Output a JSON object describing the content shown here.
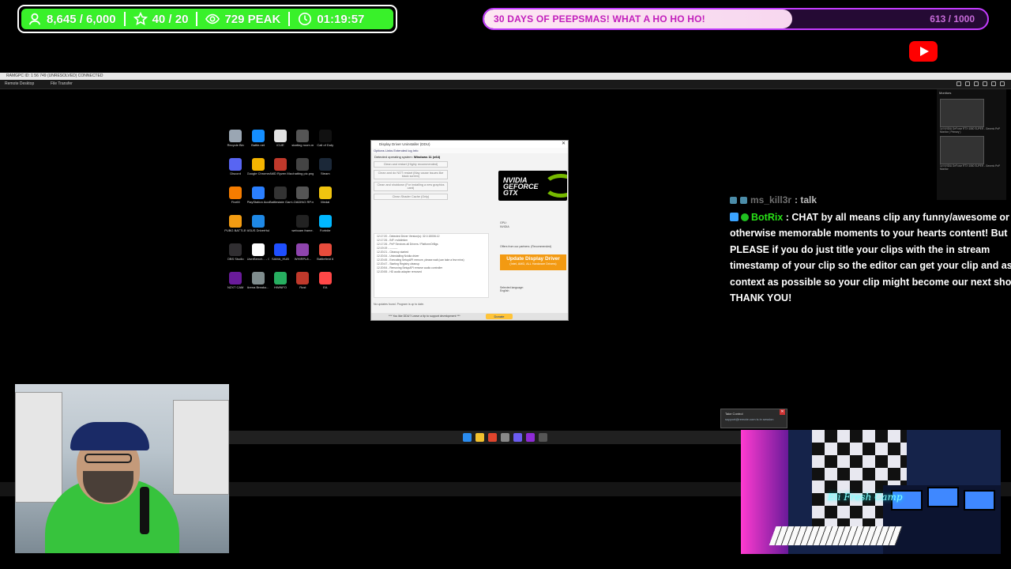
{
  "stats": {
    "followers": "8,645 / 6,000",
    "subs": "40 / 20",
    "viewers": "729 PEAK",
    "uptime": "01:19:57"
  },
  "goal": {
    "title": "30 DAYS OF PEEPSMAS! WHAT A HO HO HO!",
    "count": "613 / 1000",
    "progress_percent": 61.3
  },
  "remote_desktop": {
    "title": "RAMGPC  ID: 1 56 749 (UNRESOLVED) CONNECTED",
    "tabs": [
      "Remote Desktop",
      "File Transfer"
    ],
    "monitors_label": "Monitors",
    "monitor_captions": [
      "1# NVIDIA GeForce RTX 4080 SUPER - Generic PnP Monitor ( Primary )",
      "1# NVIDIA GeForce RTX 4080 SUPER - Generic PnP Monitor"
    ]
  },
  "desktop_icons": [
    {
      "label": "Recycle Bin",
      "color": "#9aa6b3"
    },
    {
      "label": "Battle.net",
      "color": "#148eff"
    },
    {
      "label": "iCUE",
      "color": "#e2e2e2"
    },
    {
      "label": "starting room.mp4",
      "color": "#555"
    },
    {
      "label": "Call of Duty",
      "color": "#111"
    },
    {
      "label": "Discord",
      "color": "#5865f2"
    },
    {
      "label": "Google Chrome",
      "color": "#f4b400"
    },
    {
      "label": "AMD Ryzen Master",
      "color": "#c0392b"
    },
    {
      "label": "chatting pic.png",
      "color": "#444"
    },
    {
      "label": "Steam",
      "color": "#1b2838"
    },
    {
      "label": "FiveM",
      "color": "#f57c00"
    },
    {
      "label": "PlayStation Accessories",
      "color": "#2a7fff"
    },
    {
      "label": "Battlestate Games L...",
      "color": "#333"
    },
    {
      "label": "LOADING RP.mp4",
      "color": "#555"
    },
    {
      "label": "Medal",
      "color": "#f1c40f"
    },
    {
      "label": "PUBG BATTLEGR...",
      "color": "#f39c12"
    },
    {
      "label": "ASUS DriverHub",
      "color": "#1e88e5"
    },
    {
      "label": "",
      "color": "transparent"
    },
    {
      "label": "webcam frame.png",
      "color": "#222"
    },
    {
      "label": "Fortnite",
      "color": "#00b7ff"
    },
    {
      "label": "OBS Studio",
      "color": "#302e31"
    },
    {
      "label": "UserBench... - Copy",
      "color": "#fff"
    },
    {
      "label": "SAMA_HUB",
      "color": "#1f4fff"
    },
    {
      "label": "WHIRPL8...",
      "color": "#8e44ad"
    },
    {
      "label": "Battlefield 6",
      "color": "#e74c3c"
    },
    {
      "label": "NZXT CAM",
      "color": "#6a1b9a"
    },
    {
      "label": "Arena Breako...",
      "color": "#7f8c8d"
    },
    {
      "label": "HWiNFO",
      "color": "#27ae60"
    },
    {
      "label": "Rust",
      "color": "#c0392b"
    },
    {
      "label": "EA",
      "color": "#ff4747"
    }
  ],
  "ddu": {
    "title": "Display Driver Uninstaller (DDU)",
    "menu": "Options   Links   Extended log   Info",
    "os_label": "Detected operating system:",
    "os_value": "Windows 11 (x64)",
    "buttons": [
      "Clean and restart (Highly recommended)",
      "Clean and do NOT restart (May cause issues like black screen)",
      "Clean and shutdown (For installing a new graphics card)",
      "Clean Shader Cache (Only)"
    ],
    "log_lines": [
      "12:17:20 - Detected Driver Version(s): 32.0.15006.12",
      "12:17:26 - INF: nvlddmkm",
      "12:17:26 - PnP Services all Drivers / PlatformOrBgs",
      "12:19:19 - ---------",
      "12:20:21 - Cleanup started",
      "12:20:34 - Uninstalling Nvidia driver",
      "12:20:45 - Executing SetupAPI remove, please wait (can take a few mins)",
      "12:20:47 - Starting Registry cleanup",
      "12:20:54 - Removing SetupAPI remove audio controller",
      "12:20:55 - HD audio adapter removed"
    ],
    "gpu_label": "GPU:",
    "gpu_value": "NVIDIA",
    "partners": "Offers from our partners: (Recommended)",
    "update_title": "Update Display Driver",
    "update_sub": "(Intel, AMD, ALL Hardware Drivers)",
    "lang_label": "Selected language:",
    "lang_value": "English",
    "status": "No updates found. Program is up to date.",
    "footer": "*** You like DDU? Leave a tip to support development ***",
    "donate": "Donate"
  },
  "nvidia_logo": {
    "line1": "NVIDIA",
    "line2": "GEFORCE",
    "line3": "GTX"
  },
  "chat": {
    "user1": "ms_kill3r",
    "user1_msg": ": talk",
    "bot_name": "BotRix",
    "bot_lines": [
      " : CHAT by all means clip any funny/awesome or",
      "otherwise memorable moments to your hearts content! But",
      "PLEASE if you do just title your clips with the in stream",
      "timestamp of your clip so the editor can get your clip and as",
      "context as possible so your clip might become our next short!",
      "THANK YOU!"
    ]
  },
  "toast": {
    "title": "Take Control",
    "body": "support@remote.com is in session"
  },
  "webcam_right_sign": "Eli Fresh Camp"
}
